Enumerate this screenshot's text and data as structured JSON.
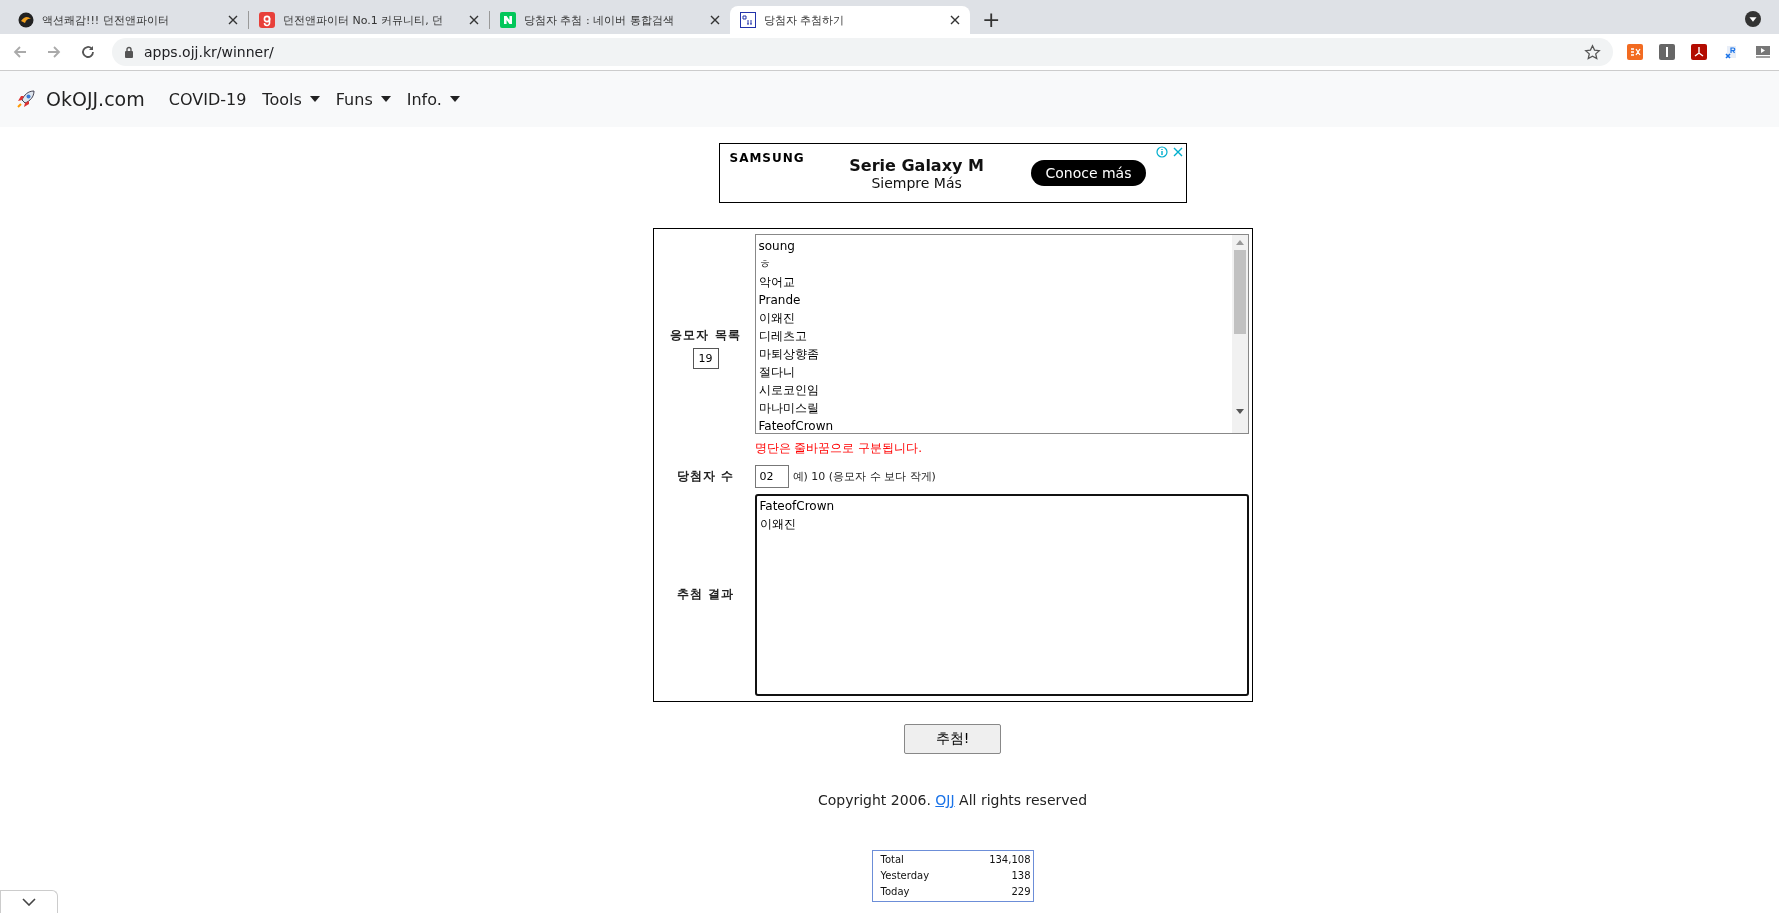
{
  "browser": {
    "tabs": [
      {
        "title": "액션쾌감!!! 던전앤파이터",
        "selected": false,
        "kind": "dragon"
      },
      {
        "title": "던전앤파이터 No.1 커뮤니티, 던",
        "selected": false,
        "kind": "g"
      },
      {
        "title": "당첨자 추첨 : 네이버 통합검색",
        "selected": false,
        "kind": "n"
      },
      {
        "title": "당첨자 추첨하기",
        "selected": true,
        "kind": "ojj"
      }
    ],
    "new_tab": "+",
    "url": "apps.ojj.kr/winner/"
  },
  "navbar": {
    "brand": "OkOJJ.com",
    "items": [
      {
        "label": "COVID-19",
        "dropdown": false
      },
      {
        "label": "Tools",
        "dropdown": true
      },
      {
        "label": "Funs",
        "dropdown": true
      },
      {
        "label": "Info.",
        "dropdown": true
      }
    ]
  },
  "ad": {
    "brand": "SAMSUNG",
    "headline": "Serie Galaxy M",
    "subline": "Siempre Más",
    "button": "Conoce más"
  },
  "form": {
    "entrants_label": "응모자 목록",
    "entrants_count": "19",
    "entrants": [
      "soung",
      "ㅎ",
      "악어교",
      "Prande",
      "이왜진",
      "디레츠고",
      "마퇴상향좀",
      "절다니",
      "시로코인임",
      "마나미스릴",
      "FateofCrown"
    ],
    "hint": "명단은 줄바꿈으로 구분됩니다.",
    "winners_label": "당첨자 수",
    "winners_count": "02",
    "winners_example": "예) 10 (응모자 수 보다 작게)",
    "result_label": "추첨 결과",
    "results": [
      "FateofCrown",
      "이왜진"
    ],
    "draw_button": "추첨!"
  },
  "footer": {
    "copyright_before": "Copyright 2006.",
    "link": "OJJ",
    "copyright_after": "All rights reserved"
  },
  "stats": [
    {
      "label": "Total",
      "value": "134,108"
    },
    {
      "label": "Yesterday",
      "value": "138"
    },
    {
      "label": "Today",
      "value": "229"
    }
  ]
}
